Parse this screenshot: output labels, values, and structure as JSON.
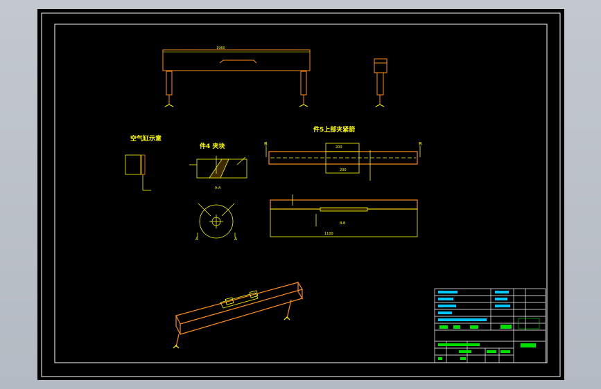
{
  "labels": {
    "air_cylinder": "空气缸示意",
    "part4_clamp": "件4 夹块",
    "part5_upper_clamp": "件5上部夹紧箭",
    "section_aa": "A-A",
    "section_bb": "B-B",
    "mark_a": "A",
    "mark_b": "B"
  },
  "dimensions": {
    "top_length": "1960",
    "bottom_length": "1100",
    "mid_width": "200",
    "mid_width2": "200"
  },
  "colors": {
    "background": "#000000",
    "frame": "#ffffff",
    "part": "#ff8c1a",
    "dimension": "#ffff00",
    "titleblock_text": "#00e000",
    "titleblock_accent": "#00c8ff"
  }
}
